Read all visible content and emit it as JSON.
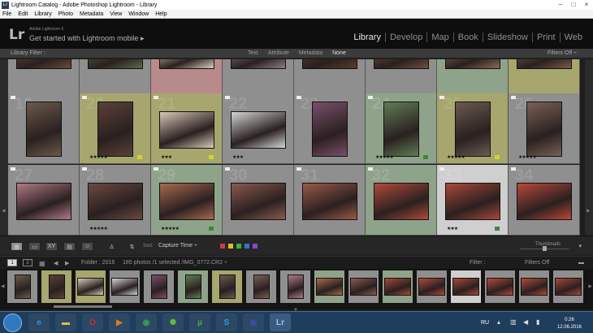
{
  "window": {
    "title": "Lightroom Catalog - Adobe Photoshop Lightroom - Library",
    "controls": [
      "–",
      "□",
      "×"
    ]
  },
  "menu": [
    "File",
    "Edit",
    "Library",
    "Photo",
    "Metadata",
    "View",
    "Window",
    "Help"
  ],
  "identity": {
    "logo": "Lr",
    "version": "Adobe Lightroom 6",
    "mobile": "Get started with Lightroom mobile ▸"
  },
  "modules": [
    {
      "label": "Library",
      "active": true
    },
    {
      "label": "Develop",
      "active": false
    },
    {
      "label": "Map",
      "active": false
    },
    {
      "label": "Book",
      "active": false
    },
    {
      "label": "Slideshow",
      "active": false
    },
    {
      "label": "Print",
      "active": false
    },
    {
      "label": "Web",
      "active": false
    }
  ],
  "filter_bar": {
    "label": "Library Filter :",
    "options": [
      {
        "label": "Text",
        "active": false
      },
      {
        "label": "Attribute",
        "active": false
      },
      {
        "label": "Metadata",
        "active": false
      },
      {
        "label": "None",
        "active": true
      }
    ],
    "filters_off": "Filters Off ÷"
  },
  "grid": {
    "rows": [
      [
        {
          "num": "",
          "bg": "#8f8f8f",
          "stars": "★★★★★",
          "tag": "#3a8a3a",
          "photo": "#6b4a3d"
        },
        {
          "num": "",
          "bg": "#8f8f8f",
          "stars": "",
          "tag": "",
          "photo": "#5a6b4a"
        },
        {
          "num": "",
          "bg": "#b98a8a",
          "stars": "★★★★★",
          "tag": "#c0392b",
          "photo": "#d9d0c0"
        },
        {
          "num": "",
          "bg": "#8f8f8f",
          "stars": "",
          "tag": "",
          "photo": "#8b8080"
        },
        {
          "num": "",
          "bg": "#8f8f8f",
          "stars": "",
          "tag": "",
          "photo": "#5b3c2c"
        },
        {
          "num": "",
          "bg": "#8f8f8f",
          "stars": "",
          "tag": "",
          "photo": "#6e5040"
        },
        {
          "num": "",
          "bg": "#8fa38a",
          "stars": "★★★★★",
          "tag": "#3a8a3a",
          "photo": "#8d6a55"
        },
        {
          "num": "",
          "bg": "#a6a66e",
          "stars": "★★★★★",
          "tag": "#d4d42a",
          "photo": "#7a5a4a"
        }
      ],
      [
        {
          "num": "19",
          "bg": "#8f8f8f",
          "stars": "",
          "tag": "",
          "photo": "#6b5a4a"
        },
        {
          "num": "20",
          "bg": "#a6a66e",
          "stars": "★★★★★",
          "tag": "#d4d42a",
          "photo": "#5a4038"
        },
        {
          "num": "21",
          "bg": "#a6a66e",
          "stars": "★★★",
          "tag": "#d4d42a",
          "photo": "#d8c8b8"
        },
        {
          "num": "22",
          "bg": "#8f8f8f",
          "stars": "★★★",
          "tag": "",
          "photo": "#d4d4d4"
        },
        {
          "num": "23",
          "bg": "#8f8f8f",
          "stars": "",
          "tag": "",
          "photo": "#7a4f6b"
        },
        {
          "num": "24",
          "bg": "#8fa38a",
          "stars": "★★★★★",
          "tag": "#3a8a3a",
          "photo": "#5f7d55"
        },
        {
          "num": "25",
          "bg": "#a6a66e",
          "stars": "★★★★★",
          "tag": "#d4d42a",
          "photo": "#6b5a50"
        },
        {
          "num": "26",
          "bg": "#8f8f8f",
          "stars": "★★★★★",
          "tag": "",
          "photo": "#7a6055"
        }
      ],
      [
        {
          "num": "27",
          "bg": "#8f8f8f",
          "stars": "",
          "tag": "",
          "photo": "#b07a88"
        },
        {
          "num": "28",
          "bg": "#8f8f8f",
          "stars": "★★★★★",
          "tag": "",
          "photo": "#6a4a40"
        },
        {
          "num": "29",
          "bg": "#8fa38a",
          "stars": "★★★★★",
          "tag": "#3a8a3a",
          "photo": "#a86a50"
        },
        {
          "num": "30",
          "bg": "#8f8f8f",
          "stars": "",
          "tag": "",
          "photo": "#8a5a50"
        },
        {
          "num": "31",
          "bg": "#8f8f8f",
          "stars": "",
          "tag": "",
          "photo": "#9a5a48"
        },
        {
          "num": "32",
          "bg": "#8fa38a",
          "stars": "",
          "tag": "",
          "photo": "#b04a3a"
        },
        {
          "num": "33",
          "bg": "#cfcfcf",
          "stars": "★★★",
          "tag": "#3a8a3a",
          "photo": "#a8483a"
        },
        {
          "num": "34",
          "bg": "#8f8f8f",
          "stars": "",
          "tag": "",
          "photo": "#b8483a"
        }
      ]
    ]
  },
  "toolbar": {
    "sort_label": "Sort:",
    "sort_value": "Capture Time ÷",
    "color_labels": [
      "#d23b3b",
      "#e0c020",
      "#3fae3f",
      "#3b6fd0",
      "#8a45c8"
    ],
    "thumbnails_label": "Thumbnails"
  },
  "filmstrip_bar": {
    "pages": [
      "1",
      "2"
    ],
    "folder": "Folder : 2016",
    "count": "185 photos /1 selected /IMG_0772.CR2 ÷",
    "filter_label": "Filter :",
    "filters_off": "Filters Off"
  },
  "filmstrip": {
    "thumbs": [
      {
        "bg": "#8f8f8f",
        "photo": "#6b5a4a",
        "portrait": true
      },
      {
        "bg": "#a6a66e",
        "photo": "#5a4038",
        "portrait": true
      },
      {
        "bg": "#a6a66e",
        "photo": "#d8c8b8",
        "portrait": false
      },
      {
        "bg": "#8f8f8f",
        "photo": "#d4d4d4",
        "portrait": false
      },
      {
        "bg": "#8f8f8f",
        "photo": "#7a4f6b",
        "portrait": true
      },
      {
        "bg": "#8fa38a",
        "photo": "#5f7d55",
        "portrait": true
      },
      {
        "bg": "#a6a66e",
        "photo": "#6b5a50",
        "portrait": true
      },
      {
        "bg": "#8f8f8f",
        "photo": "#7a6055",
        "portrait": true
      },
      {
        "bg": "#8f8f8f",
        "photo": "#b07a88",
        "portrait": true
      },
      {
        "bg": "#8fa38a",
        "photo": "#a86a50",
        "portrait": false
      },
      {
        "bg": "#8f8f8f",
        "photo": "#8a5a50",
        "portrait": false
      },
      {
        "bg": "#8fa38a",
        "photo": "#a8483a",
        "portrait": false
      },
      {
        "bg": "#8f8f8f",
        "photo": "#b04a3a",
        "portrait": false
      },
      {
        "bg": "#cfcfcf",
        "photo": "#a8483a",
        "portrait": false
      },
      {
        "bg": "#8f8f8f",
        "photo": "#b8483a",
        "portrait": false
      },
      {
        "bg": "#8f8f8f",
        "photo": "#b04a3a",
        "portrait": false
      },
      {
        "bg": "#8f8f8f",
        "photo": "#a8483a",
        "portrait": false
      }
    ]
  },
  "taskbar": {
    "apps": [
      {
        "icon": "ie-icon",
        "glyph": "e",
        "color": "#3b8ee0"
      },
      {
        "icon": "explorer-icon",
        "glyph": "▬",
        "color": "#e2b84a"
      },
      {
        "icon": "opera-icon",
        "glyph": "O",
        "color": "#d12a2a"
      },
      {
        "icon": "media-player-icon",
        "glyph": "▶",
        "color": "#e07a20"
      },
      {
        "icon": "chrome-icon",
        "glyph": "◉",
        "color": "#3aa14a"
      },
      {
        "icon": "torrent-client-icon",
        "glyph": "✺",
        "color": "#5fbf3a"
      },
      {
        "icon": "utorrent-icon",
        "glyph": "µ",
        "color": "#4cae3f"
      },
      {
        "icon": "skype-icon",
        "glyph": "S",
        "color": "#2aa0e0"
      },
      {
        "icon": "save-icon",
        "glyph": "▣",
        "color": "#3a4fa0"
      },
      {
        "icon": "lightroom-icon",
        "glyph": "Lr",
        "color": "#2b3a52"
      }
    ],
    "lang": "RU",
    "time": "0:26",
    "date": "12.06.2016"
  }
}
